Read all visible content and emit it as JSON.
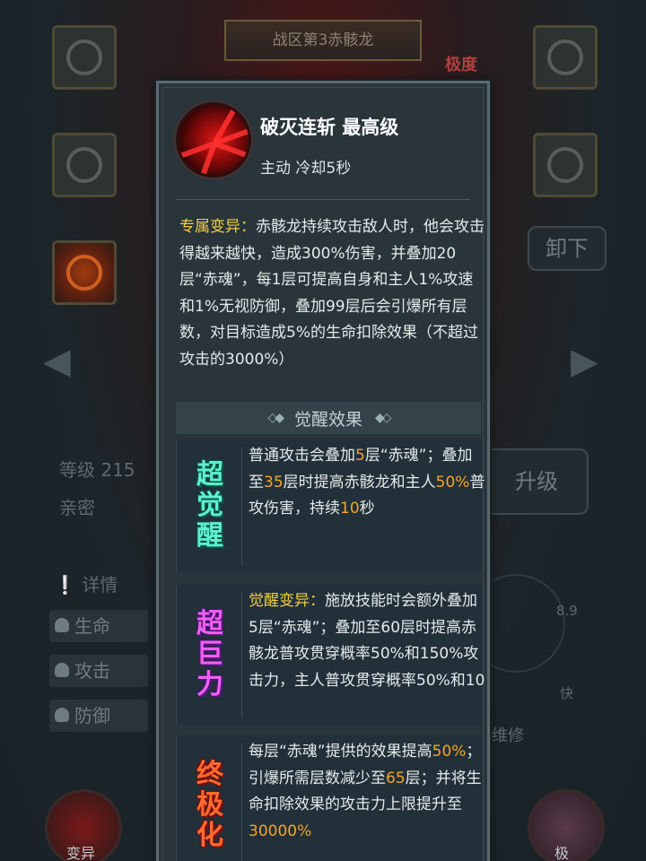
{
  "background": {
    "banner": "战区第3赤骸龙",
    "tag": "极度",
    "level": "等级 215",
    "intimacy": "亲密",
    "details": "详情",
    "unequip_button": "卸下",
    "upgrade_button": "升级",
    "stats": [
      "生命",
      "攻击",
      "防御"
    ],
    "score": "8.9",
    "speed_label": "快",
    "repair": "维修",
    "bottom_left": "变异",
    "bottom_right": "极"
  },
  "skill": {
    "name": "破灭连斩 最高级",
    "meta": "主动 冷却5秒",
    "mutation_label": "专属变异：",
    "mutation_text": "赤骸龙持续攻击敌人时，他会攻击得越来越快，造成300%伤害，并叠加20层“赤魂”，每1层可提高自身和主人1%攻速和1%无视防御，叠加99层后会引爆所有层数，对目标造成5%的生命扣除效果（不超过攻击的3000%）"
  },
  "awakening": {
    "title": "觉醒效果",
    "cards": [
      {
        "badge": "超觉醒",
        "parts": [
          {
            "t": "普通攻击会叠加"
          },
          {
            "t": "5",
            "hl": true
          },
          {
            "t": "层“赤魂”；叠加至"
          },
          {
            "t": "35",
            "hl": true
          },
          {
            "t": "层时提高赤骸龙和主人"
          },
          {
            "t": "50%",
            "hl": true
          },
          {
            "t": "普攻伤害，持续"
          },
          {
            "t": "10",
            "hl": true
          },
          {
            "t": "秒"
          }
        ]
      },
      {
        "badge": "超巨力",
        "parts": [
          {
            "t": "觉醒变异：",
            "lab": true
          },
          {
            "t": "施放技能时会额外叠加5层“赤魂”；叠加至60层时提高赤骸龙普攻贯穿概率50%和150%攻击力，主人普攻贯穿概率50%和10"
          }
        ]
      },
      {
        "badge": "终极化",
        "parts": [
          {
            "t": "每层“赤魂”提供的效果提高"
          },
          {
            "t": "50%",
            "hl": true
          },
          {
            "t": "；引爆所需层数减少至"
          },
          {
            "t": "65",
            "hl": true
          },
          {
            "t": "层；并将生命扣除效果的攻击力上限提升至"
          },
          {
            "t": "30000%",
            "hl": true
          }
        ]
      }
    ]
  },
  "colors": {
    "panel_bg": "#29353b",
    "label_yellow": "#f4d03e",
    "highlight_orange": "#f5a623"
  }
}
